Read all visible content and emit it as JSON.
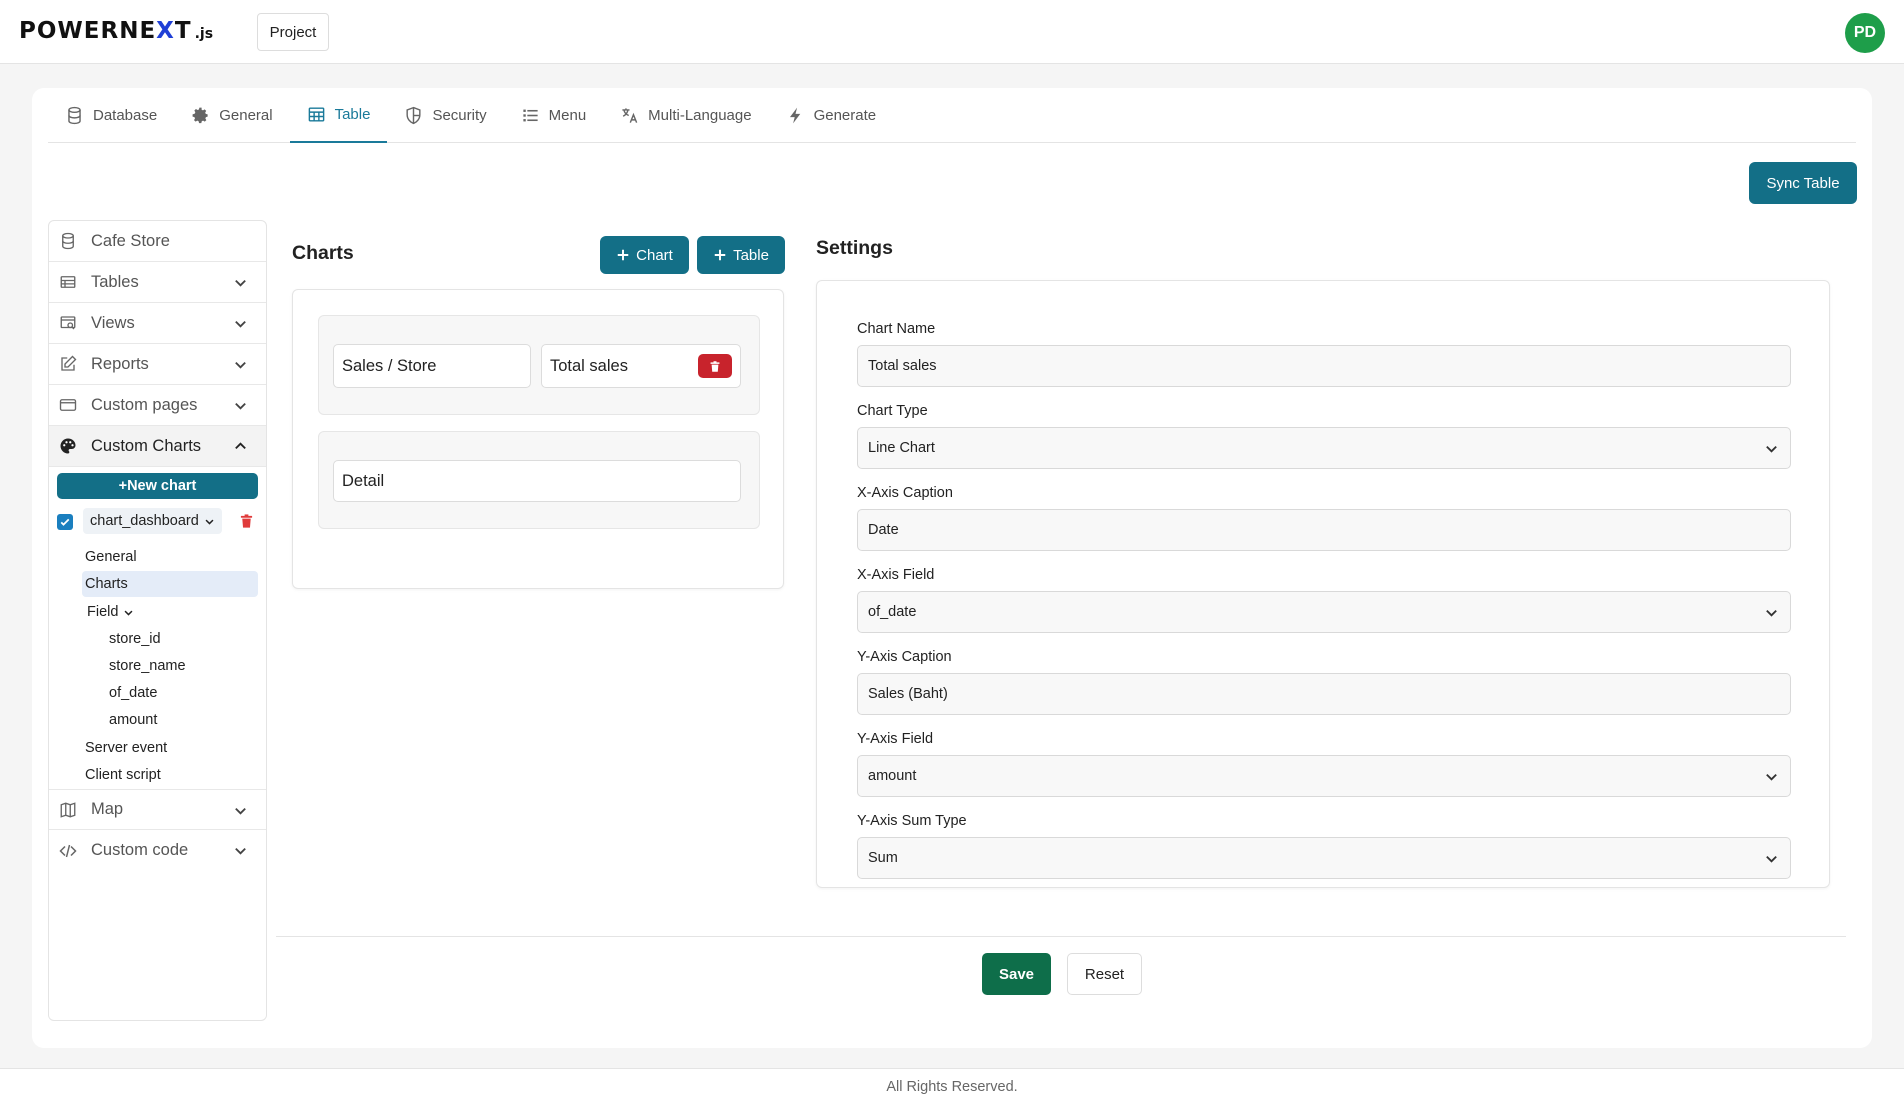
{
  "header": {
    "logo_main": "POWERNE",
    "logo_mark": "X",
    "logo_rest": "T",
    "logo_suffix": ".js",
    "project_label": "Project",
    "avatar_initials": "PD"
  },
  "tabs": [
    {
      "label": "Database",
      "icon": "database-icon"
    },
    {
      "label": "General",
      "icon": "gear-icon"
    },
    {
      "label": "Table",
      "icon": "table-icon",
      "active": true
    },
    {
      "label": "Security",
      "icon": "shield-icon"
    },
    {
      "label": "Menu",
      "icon": "list-icon"
    },
    {
      "label": "Multi-Language",
      "icon": "translate-icon"
    },
    {
      "label": "Generate",
      "icon": "lightning-icon"
    }
  ],
  "sync_label": "Sync Table",
  "sidebar": {
    "project_name": "Cafe Store",
    "items": [
      {
        "label": "Tables",
        "icon": "table-list-icon"
      },
      {
        "label": "Views",
        "icon": "view-icon"
      },
      {
        "label": "Reports",
        "icon": "edit-icon"
      },
      {
        "label": "Custom pages",
        "icon": "page-icon"
      },
      {
        "label": "Custom Charts",
        "icon": "palette-icon",
        "expanded": true
      },
      {
        "label": "Map",
        "icon": "map-icon"
      },
      {
        "label": "Custom code",
        "icon": "code-icon"
      }
    ],
    "new_chart_label": "+New chart",
    "chart_name": "chart_dashboard",
    "tree": {
      "general": "General",
      "charts": "Charts",
      "field": "Field",
      "fields": [
        "store_id",
        "store_name",
        "of_date",
        "amount"
      ],
      "server_event": "Server event",
      "client_script": "Client script"
    }
  },
  "charts_panel": {
    "title": "Charts",
    "add_chart_label": "Chart",
    "add_table_label": "Table",
    "group1": [
      "Sales / Store",
      "Total sales"
    ],
    "group2": [
      "Detail"
    ]
  },
  "settings": {
    "title": "Settings",
    "chart_name_label": "Chart Name",
    "chart_name_value": "Total sales",
    "chart_type_label": "Chart Type",
    "chart_type_value": "Line Chart",
    "x_caption_label": "X-Axis Caption",
    "x_caption_value": "Date",
    "x_field_label": "X-Axis Field",
    "x_field_value": "of_date",
    "y_caption_label": "Y-Axis Caption",
    "y_caption_value": "Sales (Baht)",
    "y_field_label": "Y-Axis Field",
    "y_field_value": "amount",
    "y_sum_label": "Y-Axis Sum Type",
    "y_sum_value": "Sum"
  },
  "actions": {
    "save_label": "Save",
    "reset_label": "Reset"
  },
  "footer": {
    "text": "All Rights Reserved."
  },
  "colors": {
    "primary": "#136f87",
    "save": "#0e6e4a",
    "danger": "#c8232c",
    "avatar": "#1e9e4a",
    "logo_accent": "#1f3fd6"
  }
}
